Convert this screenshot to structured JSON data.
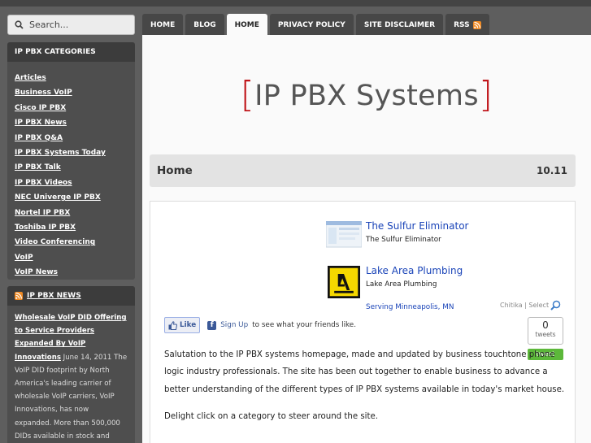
{
  "search": {
    "placeholder": "Search..."
  },
  "sidebar": {
    "categories_title": "IP PBX CATEGORIES",
    "categories": [
      "Articles",
      "Business VoIP",
      "Cisco IP PBX",
      "IP PBX News",
      "IP PBX Q&A",
      "IP PBX Systems Today",
      "IP PBX Talk",
      "IP PBX Videos",
      "NEC Univerge IP PBX",
      "Nortel IP PBX",
      "Toshiba IP PBX",
      "Video Conferencing",
      "VoIP",
      "VoIP News"
    ],
    "news_title": "IP PBX NEWS",
    "news_item": {
      "title": "Wholesale VoIP DID Offering to Service Providers Expanded By VoIP Innovations",
      "date": "June 14, 2011",
      "excerpt": "The VoIP DID footprint by North America's leading carrier of wholesale VoIP carriers, VoIP Innovations, has now expanded. More than 500,000 DIDs available in stock and about"
    }
  },
  "nav": {
    "tabs": [
      "HOME",
      "BLOG",
      "HOME",
      "PRIVACY POLICY",
      "SITE DISCLAIMER",
      "RSS"
    ],
    "active_index": 2
  },
  "site": {
    "logo_text": "IP PBX Systems"
  },
  "page": {
    "title": "Home",
    "version": "10.11"
  },
  "ads": [
    {
      "title": "The Sulfur Eliminator",
      "subtitle": "The Sulfur Eliminator",
      "location": ""
    },
    {
      "title": "Lake Area Plumbing",
      "subtitle": "Lake Area Plumbing",
      "location": "Serving Minneapolis, MN"
    }
  ],
  "chitika": {
    "label": "Chitika | Select"
  },
  "facebook": {
    "like_label": "Like",
    "signup_label": "Sign Up",
    "signup_suffix": "to see what your friends like."
  },
  "tweet": {
    "count": "0",
    "count_label": "tweets",
    "button_label": "tweet"
  },
  "content": {
    "paragraph1": "Salutation to the IP PBX systems homepage, made and updated by business touchtone phone logic industry professionals. The site has been out together to enable business to advance a better understanding of the different types of IP PBX systems available in today's market house.",
    "paragraph2": "Delight click on a category to steer around the site."
  },
  "colors": {
    "accent_red": "#c0161b",
    "link_blue": "#1a44b8",
    "tweet_green": "#5cb83a",
    "rss_orange": "#f08a24"
  }
}
